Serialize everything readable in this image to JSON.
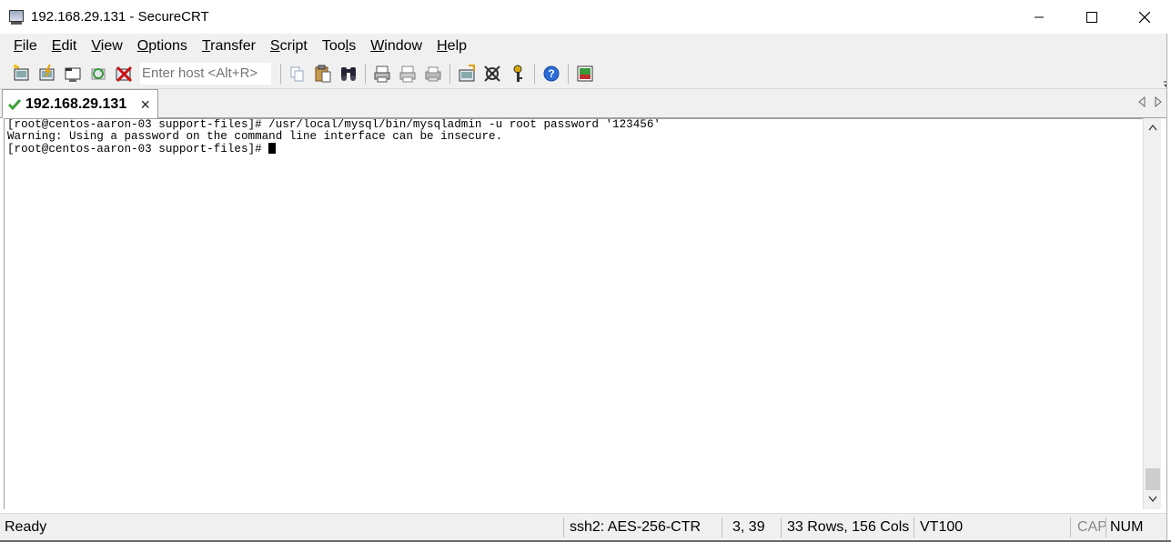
{
  "window": {
    "title": "192.168.29.131 - SecureCRT",
    "icon": "securecrt-app-icon"
  },
  "menu": [
    {
      "pre": "",
      "ul": "F",
      "post": "ile"
    },
    {
      "pre": "",
      "ul": "E",
      "post": "dit"
    },
    {
      "pre": "",
      "ul": "V",
      "post": "iew"
    },
    {
      "pre": "",
      "ul": "O",
      "post": "ptions"
    },
    {
      "pre": "",
      "ul": "T",
      "post": "ransfer"
    },
    {
      "pre": "",
      "ul": "S",
      "post": "cript"
    },
    {
      "pre": "Too",
      "ul": "l",
      "post": "s"
    },
    {
      "pre": "",
      "ul": "W",
      "post": "indow"
    },
    {
      "pre": "",
      "ul": "H",
      "post": "elp"
    }
  ],
  "toolbar": {
    "host_placeholder": "Enter host <Alt+R>",
    "icons": [
      "connect-icon",
      "quick-connect-icon",
      "connect-in-tab-icon",
      "reconnect-icon",
      "disconnect-icon",
      "copy-icon",
      "paste-icon",
      "find-icon",
      "print-screen-icon",
      "print-selection-icon",
      "print-icon",
      "session-options-icon",
      "global-options-icon",
      "keymap-icon",
      "help-icon",
      "sftp-icon"
    ]
  },
  "tab": {
    "label": "192.168.29.131",
    "status_icon": "connected-check-icon",
    "close_glyph": "×"
  },
  "terminal": {
    "lines": [
      "[root@centos-aaron-03 support-files]# /usr/local/mysql/bin/mysqladmin -u root password '123456'",
      "Warning: Using a password on the command line interface can be insecure.",
      "[root@centos-aaron-03 support-files]# "
    ]
  },
  "status": {
    "state": "Ready",
    "protocol": "ssh2: AES-256-CTR",
    "cursor_pos": "3,  39",
    "size": "33 Rows, 156 Cols",
    "emulation": "VT100",
    "caps": "CAP",
    "num": "NUM"
  }
}
